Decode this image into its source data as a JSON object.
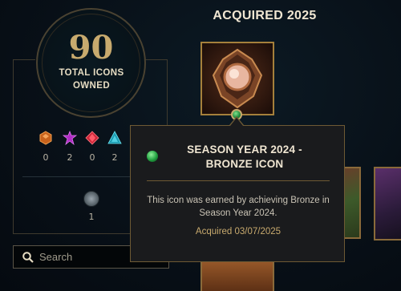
{
  "summary": {
    "count": "90",
    "label": "TOTAL ICONS OWNED"
  },
  "gems": [
    {
      "name": "orange-gem-icon",
      "color": "#e07a2a",
      "count": "0"
    },
    {
      "name": "purple-gem-icon",
      "color": "#c03ad0",
      "count": "2"
    },
    {
      "name": "red-gem-icon",
      "color": "#e03040",
      "count": "0"
    },
    {
      "name": "cyan-gem-icon",
      "color": "#30c0d0",
      "count": "2"
    }
  ],
  "emblem": {
    "icon": "crest-emblem-icon",
    "count": "1"
  },
  "search": {
    "placeholder": "Search",
    "value": ""
  },
  "section": {
    "title": "ACQUIRED 2025"
  },
  "tooltip": {
    "title": "SEASON YEAR 2024 - BRONZE ICON",
    "description": "This icon was earned by achieving Bronze in Season Year 2024.",
    "acquired": "Acquired 03/07/2025",
    "accent_color": "#c8aa6e"
  }
}
